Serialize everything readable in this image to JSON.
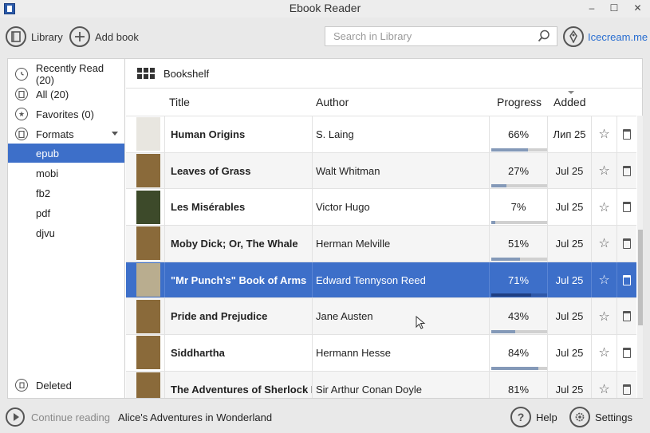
{
  "window": {
    "title": "Ebook Reader",
    "min": "–",
    "max": "☐",
    "close": "✕"
  },
  "toolbar": {
    "library_label": "Library",
    "add_book_label": "Add book",
    "search_placeholder": "Search in Library",
    "brand_label": "Icecream.me"
  },
  "sidebar": {
    "items": [
      {
        "label": "Recently Read (20)",
        "icon": "clock-icon"
      },
      {
        "label": "All (20)",
        "icon": "book-icon"
      },
      {
        "label": "Favorites (0)",
        "icon": "star-icon"
      },
      {
        "label": "Formats",
        "icon": "book-icon"
      }
    ],
    "formats": [
      "epub",
      "mobi",
      "fb2",
      "pdf",
      "djvu"
    ],
    "active_format": "epub",
    "deleted_label": "Deleted"
  },
  "view": {
    "label": "Bookshelf"
  },
  "columns": {
    "title": "Title",
    "author": "Author",
    "progress": "Progress",
    "added": "Added"
  },
  "books": [
    {
      "title": "Human Origins",
      "author": "S. Laing",
      "progress": "66%",
      "progress_value": 0.66,
      "added": "Лип 25",
      "cover_color": "#e8e6e0"
    },
    {
      "title": "Leaves of Grass",
      "author": "Walt Whitman",
      "progress": "27%",
      "progress_value": 0.27,
      "added": "Jul 25",
      "cover_color": "#8a6a3a"
    },
    {
      "title": "Les Misérables",
      "author": "Victor Hugo",
      "progress": "7%",
      "progress_value": 0.07,
      "added": "Jul 25",
      "cover_color": "#3d4a2a"
    },
    {
      "title": "Moby Dick; Or, The Whale",
      "author": "Herman Melville",
      "progress": "51%",
      "progress_value": 0.51,
      "added": "Jul 25",
      "cover_color": "#8a6a3a"
    },
    {
      "title": "\"Mr Punch's\" Book of Arms",
      "author": "Edward Tennyson Reed",
      "progress": "71%",
      "progress_value": 0.71,
      "added": "Jul 25",
      "cover_color": "#b9ad8f"
    },
    {
      "title": "Pride and Prejudice",
      "author": "Jane Austen",
      "progress": "43%",
      "progress_value": 0.43,
      "added": "Jul 25",
      "cover_color": "#8a6a3a"
    },
    {
      "title": "Siddhartha",
      "author": "Hermann Hesse",
      "progress": "84%",
      "progress_value": 0.84,
      "added": "Jul 25",
      "cover_color": "#8a6a3a"
    },
    {
      "title": "The Adventures of Sherlock Holmes",
      "author": "Sir Arthur Conan Doyle",
      "progress": "81%",
      "progress_value": 0.81,
      "added": "Jul 25",
      "cover_color": "#8a6a3a"
    }
  ],
  "selected_index": 4,
  "bottom": {
    "continue_label": "Continue reading",
    "continue_title": "Alice's Adventures in Wonderland",
    "help_label": "Help",
    "settings_label": "Settings"
  },
  "colors": {
    "accent": "#3d6fc9",
    "link": "#2a6fd1"
  }
}
